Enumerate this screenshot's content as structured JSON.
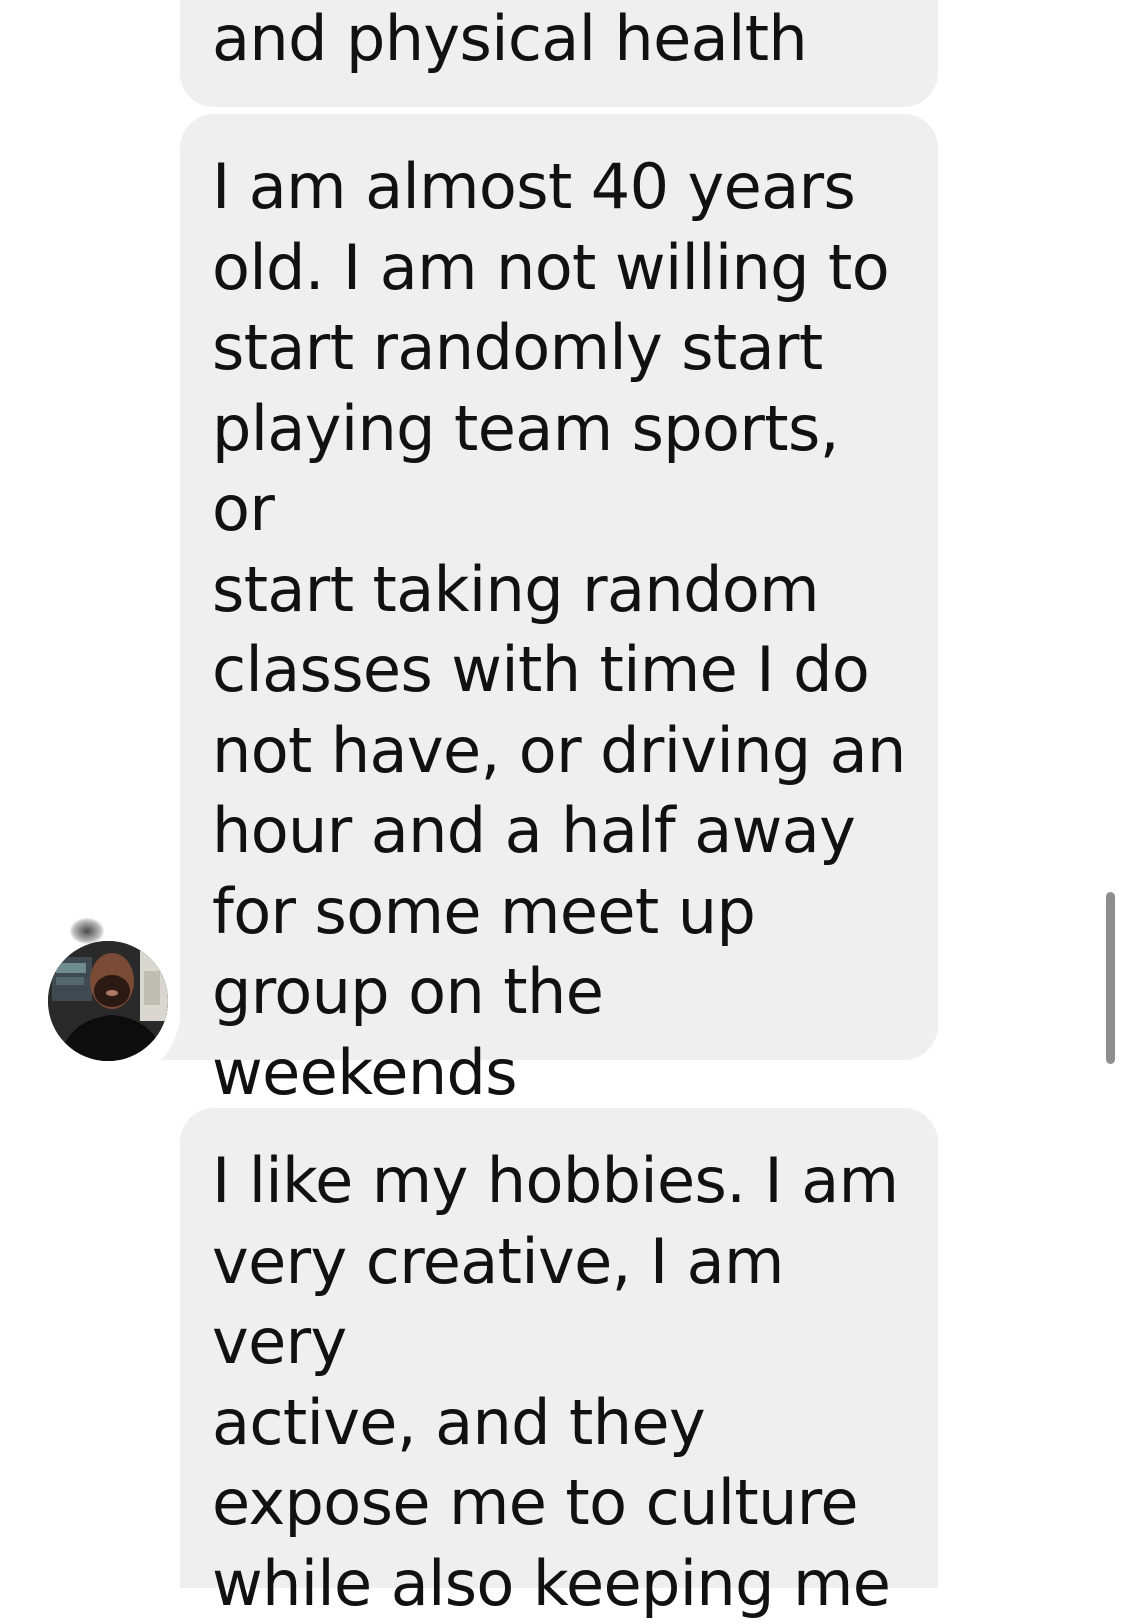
{
  "conversation": {
    "messages": [
      {
        "sender": "other",
        "text": "and physical health"
      },
      {
        "sender": "other",
        "text": "I am almost 40 years\nold. I am not willing to\nstart randomly start\nplaying team sports, or\nstart taking random\nclasses with time I do\nnot have, or driving an\nhour and a half away\nfor some meet up\ngroup on the\nweekends"
      },
      {
        "sender": "other",
        "text": "I like my hobbies. I am\nvery creative, I am very\nactive, and they\nexpose me to culture\nwhile also keeping me"
      }
    ],
    "avatar_icon": "user-avatar-photo"
  },
  "colors": {
    "bubble_background": "#efefef",
    "text": "#111111",
    "page_background": "#ffffff",
    "scrollbar": "#8e8e8e"
  }
}
